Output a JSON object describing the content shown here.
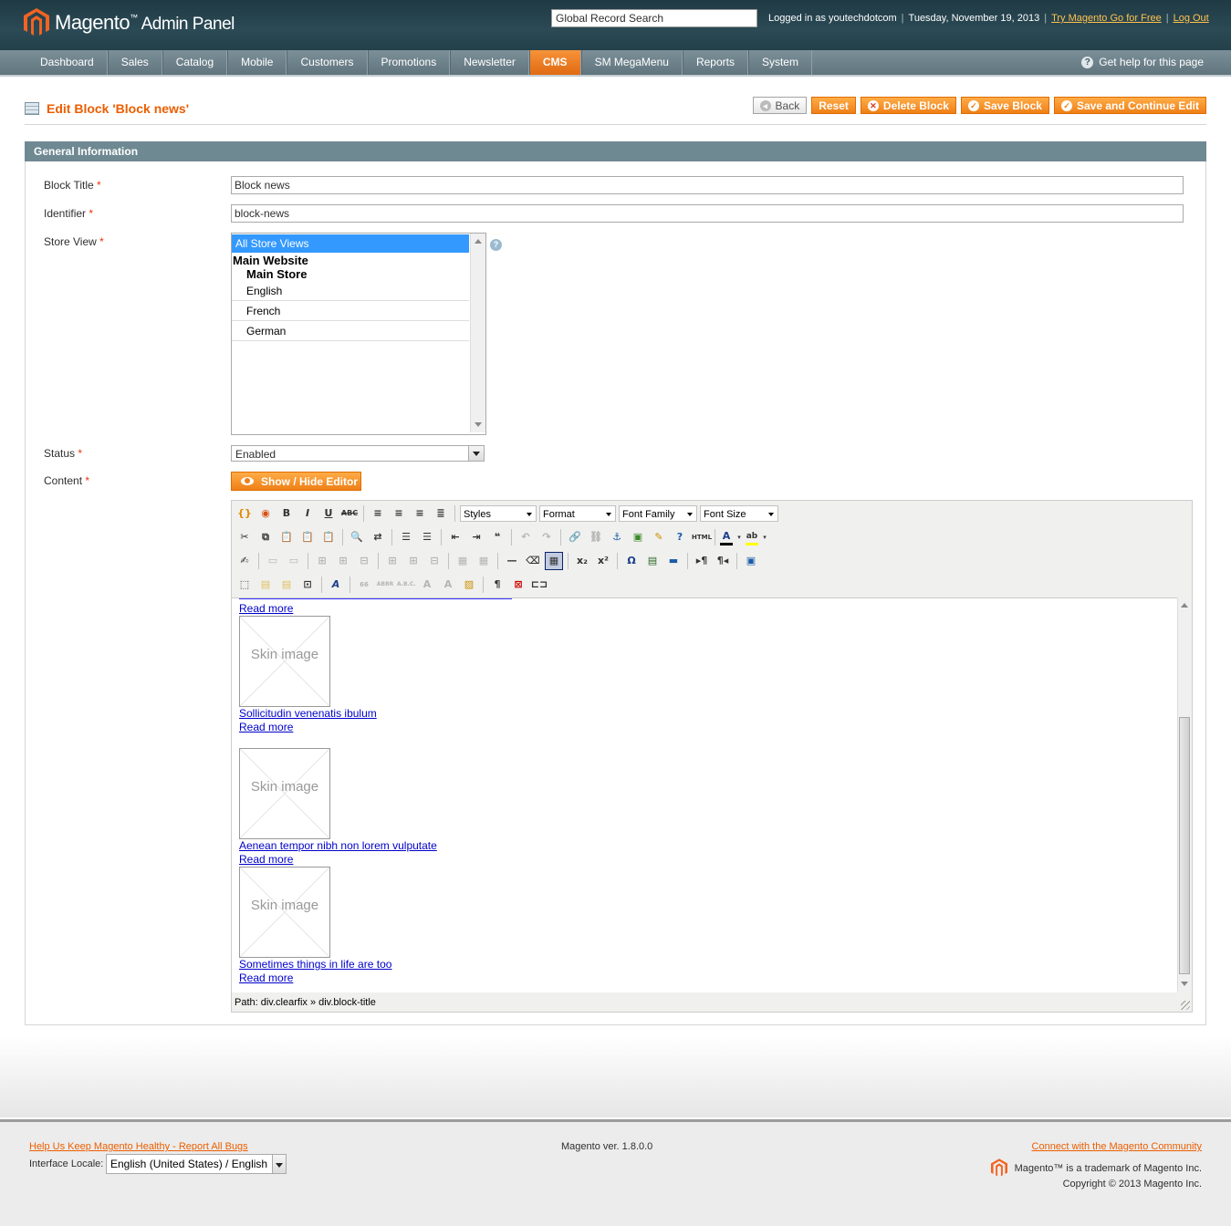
{
  "header": {
    "logo_text": "Magento",
    "logo_tm": "™",
    "logo_suffix": "Admin Panel",
    "search_value": "Global Record Search",
    "logged_in": "Logged in as youtechdotcom",
    "date": "Tuesday, November 19, 2013",
    "try_link": "Try Magento Go for Free",
    "logout": "Log Out",
    "separator": "|"
  },
  "nav": {
    "items": [
      "Dashboard",
      "Sales",
      "Catalog",
      "Mobile",
      "Customers",
      "Promotions",
      "Newsletter",
      "CMS",
      "SM MegaMenu",
      "Reports",
      "System"
    ],
    "active": "CMS",
    "help": "Get help for this page"
  },
  "page": {
    "title": "Edit Block 'Block news'",
    "buttons": {
      "back": "Back",
      "reset": "Reset",
      "delete": "Delete Block",
      "save": "Save Block",
      "save_continue": "Save and Continue Edit"
    }
  },
  "form": {
    "section": "General Information",
    "required_mark": "*",
    "block_title_label": "Block Title",
    "block_title_value": "Block news",
    "identifier_label": "Identifier",
    "identifier_value": "block-news",
    "store_view_label": "Store View",
    "store_views": {
      "selected": "All Store Views",
      "website": "Main Website",
      "store": "Main Store",
      "views": [
        "English",
        "French",
        "German"
      ]
    },
    "status_label": "Status",
    "status_value": "Enabled",
    "content_label": "Content",
    "show_hide": "Show / Hide Editor"
  },
  "editor": {
    "dropdowns": {
      "styles": "Styles",
      "format": "Format",
      "font_family": "Font Family",
      "font_size": "Font Size"
    },
    "read_more": "Read more ",
    "skin_image": "Skin image",
    "items": [
      "Sollicitudin venenatis ibulum",
      "Aenean tempor nibh non lorem vulputate",
      "Sometimes things in life are too"
    ],
    "path": "Path: div.clearfix » div.block-title"
  },
  "footer": {
    "help_link": "Help Us Keep Magento Healthy - Report All Bugs",
    "locale_label": "Interface Locale:",
    "locale_value": "English (United States) / English",
    "version": "Magento ver. 1.8.0.0",
    "community_link": "Connect with the Magento Community",
    "trademark": "Magento™ is a trademark of Magento Inc.",
    "copyright": "Copyright © 2013 Magento Inc."
  },
  "colors": {
    "accent": "#eb5e00",
    "header_bg": "#2b4a55",
    "nav_bg": "#6f8992",
    "link": "#0000cc"
  }
}
